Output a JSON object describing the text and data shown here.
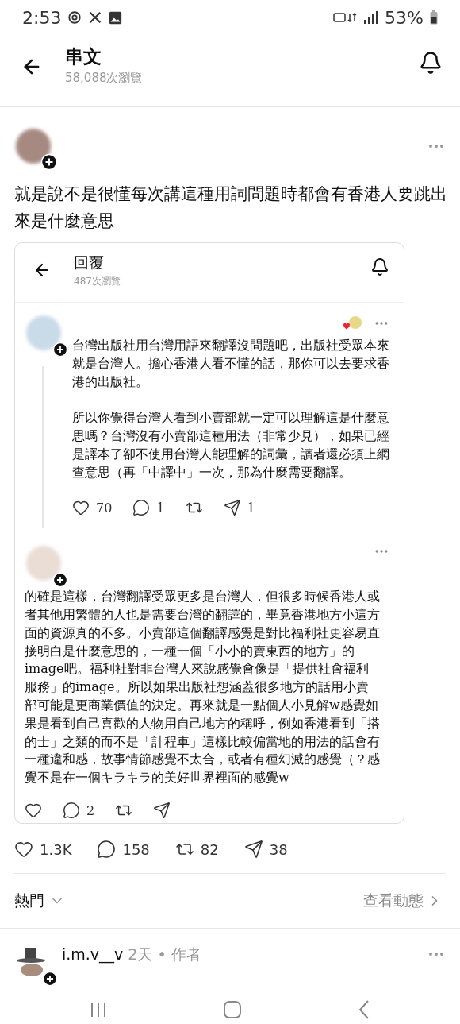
{
  "status_bar": {
    "time": "2:53",
    "battery": "53%"
  },
  "header": {
    "title": "串文",
    "views": "58,088次瀏覽"
  },
  "post": {
    "text": "就是說不是很懂每次講這種用詞問題時都會有香港人要跳出來是什麼意思",
    "stats": [
      {
        "kind": "like",
        "count": "1.3K"
      },
      {
        "kind": "reply",
        "count": "158"
      },
      {
        "kind": "repost",
        "count": "82"
      },
      {
        "kind": "share",
        "count": "38"
      }
    ]
  },
  "quoted": {
    "title": "回覆",
    "views": "487次瀏覽",
    "replies": [
      {
        "paragraphs": [
          "台灣出版社用台灣用語來翻譯沒問題吧，出版社受眾本來就是台灣人。擔心香港人看不懂的話，那你可以去要求香港的出版社。",
          "所以你覺得台灣人看到小賣部就一定可以理解這是什麼意思嗎？台灣沒有小賣部這種用法（非常少見），如果已經是譯本了卻不使用台灣人能理解的詞彙，讀者還必須上網查意思（再「中譯中」一次，那為什麼需要翻譯。"
        ],
        "reaction": true,
        "stats": [
          {
            "kind": "like",
            "count": "70"
          },
          {
            "kind": "reply",
            "count": "1"
          },
          {
            "kind": "repost"
          },
          {
            "kind": "share",
            "count": "1"
          }
        ]
      },
      {
        "paragraphs": [
          "的確是這樣，台灣翻譯受眾更多是台灣人，但很多時候香港人或者其他用繁體的人也是需要台灣的翻譯的，畢竟香港地方小這方面的資源真的不多。小賣部這個翻譯感覺是對比福利社更容易直接明白是什麼意思的，一種一個「小小的賣東西的地方」的image吧。福利社對非台灣人來說感覺會像是「提供社會福利服務」的image。所以如果出版社想涵蓋很多地方的話用小賣部可能是更商業價值的決定。再來就是一點個人小見解w感覺如果是看到自己喜歡的人物用自己地方的稱呼，例如香港看到「搭的士」之類的而不是「計程車」這樣比較偏當地的用法的話會有一種違和感，故事情節感覺不太合，或者有種幻滅的感覺（？感覺不是在一個キラキラ的美好世界裡面的感覺w"
        ],
        "reaction": false,
        "stats": [
          {
            "kind": "like"
          },
          {
            "kind": "reply",
            "count": "2"
          },
          {
            "kind": "repost"
          },
          {
            "kind": "share"
          }
        ]
      }
    ]
  },
  "sort": {
    "label": "熱門",
    "link": "查看動態"
  },
  "comment": {
    "username": "i.m.v__v",
    "time": "2天",
    "separator": "•",
    "role": "作者"
  }
}
